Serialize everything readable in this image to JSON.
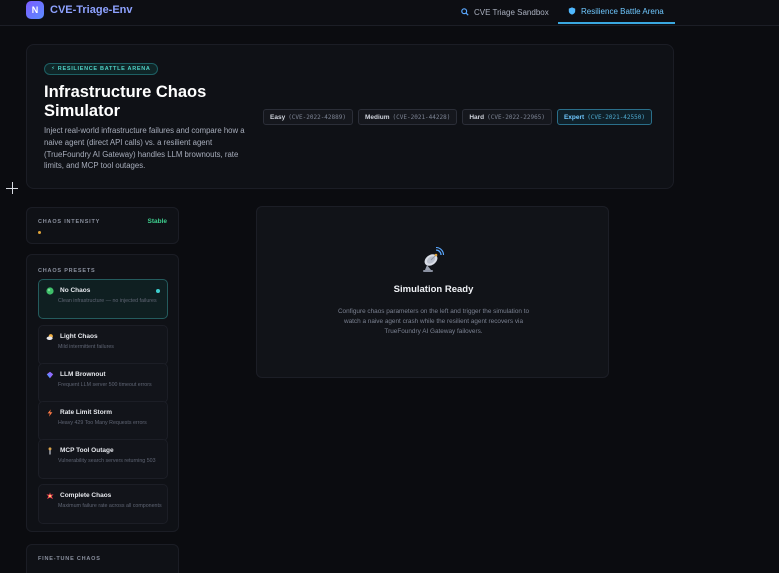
{
  "app": {
    "logo_letter": "N",
    "title": "CVE-Triage-Env"
  },
  "nav": {
    "tabs": [
      {
        "label": "CVE Triage Sandbox",
        "icon": "search-icon"
      },
      {
        "label": "Resilience Battle Arena",
        "icon": "shield-icon",
        "active": true
      }
    ]
  },
  "hero": {
    "badge": "⚡ RESILIENCE BATTLE ARENA",
    "title": "Infrastructure Chaos Simulator",
    "description": "Inject real-world infrastructure failures and compare how a naive agent (direct API calls) vs. a resilient agent (TrueFoundry AI Gateway) handles LLM brownouts, rate limits, and MCP tool outages.",
    "difficulties": [
      {
        "level": "Easy",
        "cve": "(CVE-2022-42889)"
      },
      {
        "level": "Medium",
        "cve": "(CVE-2021-44228)"
      },
      {
        "level": "Hard",
        "cve": "(CVE-2022-22965)"
      },
      {
        "level": "Expert",
        "cve": "(CVE-2021-42550)",
        "active": true
      }
    ]
  },
  "intensity": {
    "label": "CHAOS INTENSITY",
    "status": "Stable",
    "status_color": "#3ecf8e"
  },
  "presets": {
    "label": "CHAOS PRESETS",
    "items": [
      {
        "name": "No Chaos",
        "desc": "Clean infrastructure — no injected failures",
        "icon": "green-circle-icon",
        "active": true
      },
      {
        "name": "Light Chaos",
        "desc": "Mild intermittent failures",
        "icon": "cloud-sun-icon"
      },
      {
        "name": "LLM Brownout",
        "desc": "Frequent LLM server 500 timeout errors",
        "icon": "brain-icon"
      },
      {
        "name": "Rate Limit Storm",
        "desc": "Heavy 429 Too Many Requests errors",
        "icon": "lightning-icon"
      },
      {
        "name": "MCP Tool Outage",
        "desc": "Vulnerability search servers returning 503",
        "icon": "wrench-icon"
      },
      {
        "name": "Complete Chaos",
        "desc": "Maximum failure rate across all components",
        "icon": "explosion-icon"
      }
    ]
  },
  "finetune": {
    "label": "FINE-TUNE CHAOS"
  },
  "simulation": {
    "icon": "satellite-dish-icon",
    "title": "Simulation Ready",
    "description": "Configure chaos parameters on the left and trigger the simulation to watch a naive agent crash while the resilient agent recovers via TrueFoundry AI Gateway failovers."
  }
}
